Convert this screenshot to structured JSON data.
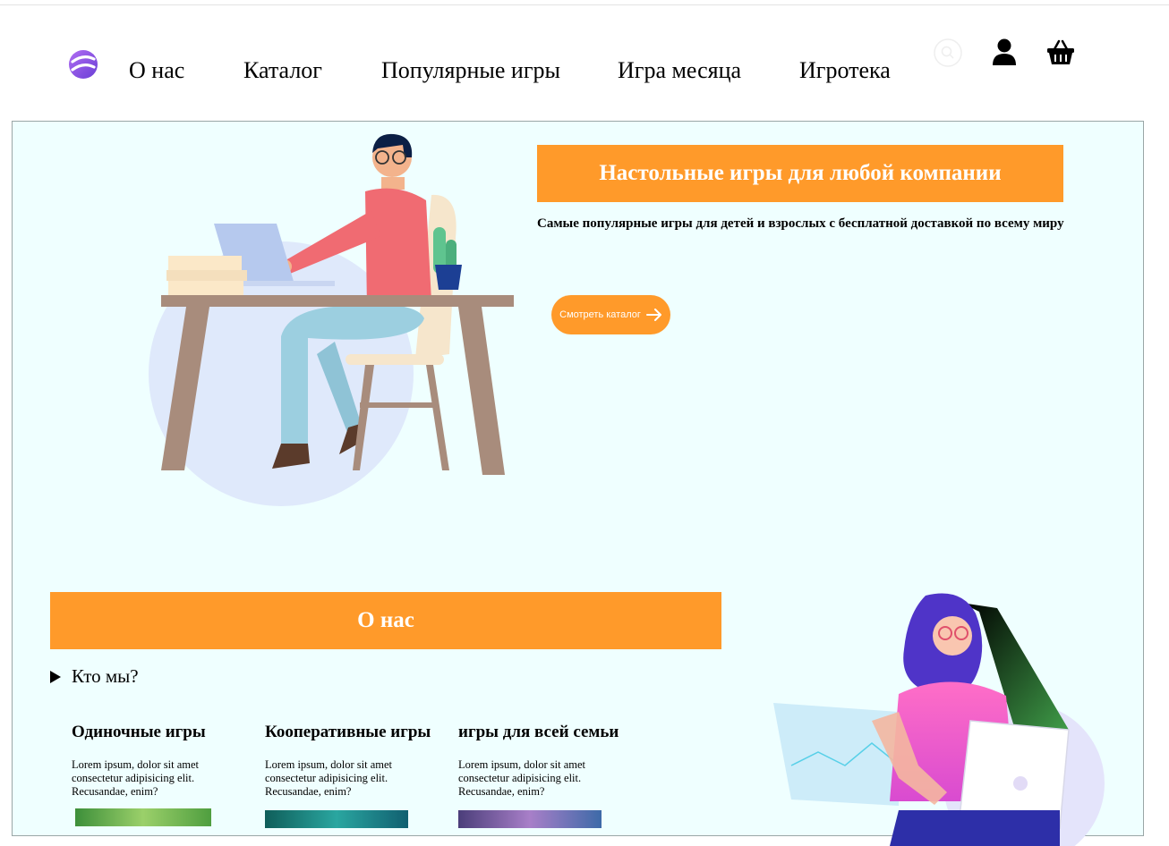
{
  "nav": {
    "items": [
      {
        "label": "О нас"
      },
      {
        "label": "Каталог"
      },
      {
        "label": "Популярные игры"
      },
      {
        "label": "Игра месяца"
      },
      {
        "label": "Игротека"
      }
    ]
  },
  "header_icons": [
    "search-icon",
    "user-icon",
    "basket-icon"
  ],
  "hero": {
    "title": "Настольные игры для любой компании",
    "subtitle": "Самые популярные игры для детей и взрослых с бесплатной доставкой по всему миру",
    "cta_label": "Смотреть каталог"
  },
  "about": {
    "title": "О нас",
    "toggle_label": "Кто мы?",
    "features": [
      {
        "title": "Одиночные игры",
        "text": "Lorem ipsum, dolor sit amet consectetur adipisicing elit. Recusandae, enim?"
      },
      {
        "title": "Кооперативные игры",
        "text": "Lorem ipsum, dolor sit amet consectetur adipisicing elit. Recusandae, enim?"
      },
      {
        "title": "игры для всей семьи",
        "text": "Lorem ipsum, dolor sit amet consectetur adipisicing elit. Recusandae, enim?"
      }
    ]
  },
  "colors": {
    "accent": "#ff9a2a",
    "hero_bg": "#efffff",
    "logo": "#8b4fe0"
  }
}
